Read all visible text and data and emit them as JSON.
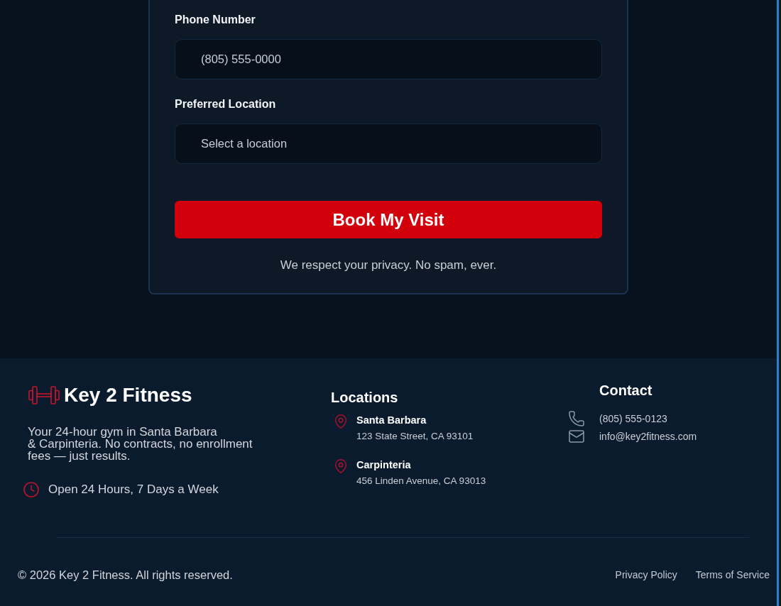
{
  "form": {
    "fields": [
      {
        "label": "Phone Number",
        "placeholder": "(805) 555-0000"
      },
      {
        "label": "Preferred Location",
        "placeholder": "Select a location"
      }
    ],
    "submit_button": "Book My Visit",
    "privacy_note": "We respect your privacy. No spam, ever."
  },
  "footer": {
    "brand": {
      "name": "Key 2 Fitness",
      "description": "Your 24-hour gym in Santa Barbara\n& Carpinteria. No contracts, no enrollment fees — just results.",
      "hours": "Open 24 Hours, 7 Days a Week"
    },
    "locations": {
      "title": "Locations",
      "items": [
        {
          "name": "Santa Barbara",
          "address": "123 State Street, CA 93101"
        },
        {
          "name": "Carpinteria",
          "address": "456 Linden Avenue, CA 93013"
        }
      ]
    },
    "contact": {
      "title": "Contact",
      "items": [
        {
          "kind": "phone",
          "text": "(805) 555-0123"
        },
        {
          "kind": "email",
          "text": "info@key2fitness.com"
        }
      ]
    },
    "copyright": "© 2026 Key 2 Fitness. All rights reserved.",
    "links": [
      "Privacy Policy",
      "Terms of Service"
    ]
  }
}
